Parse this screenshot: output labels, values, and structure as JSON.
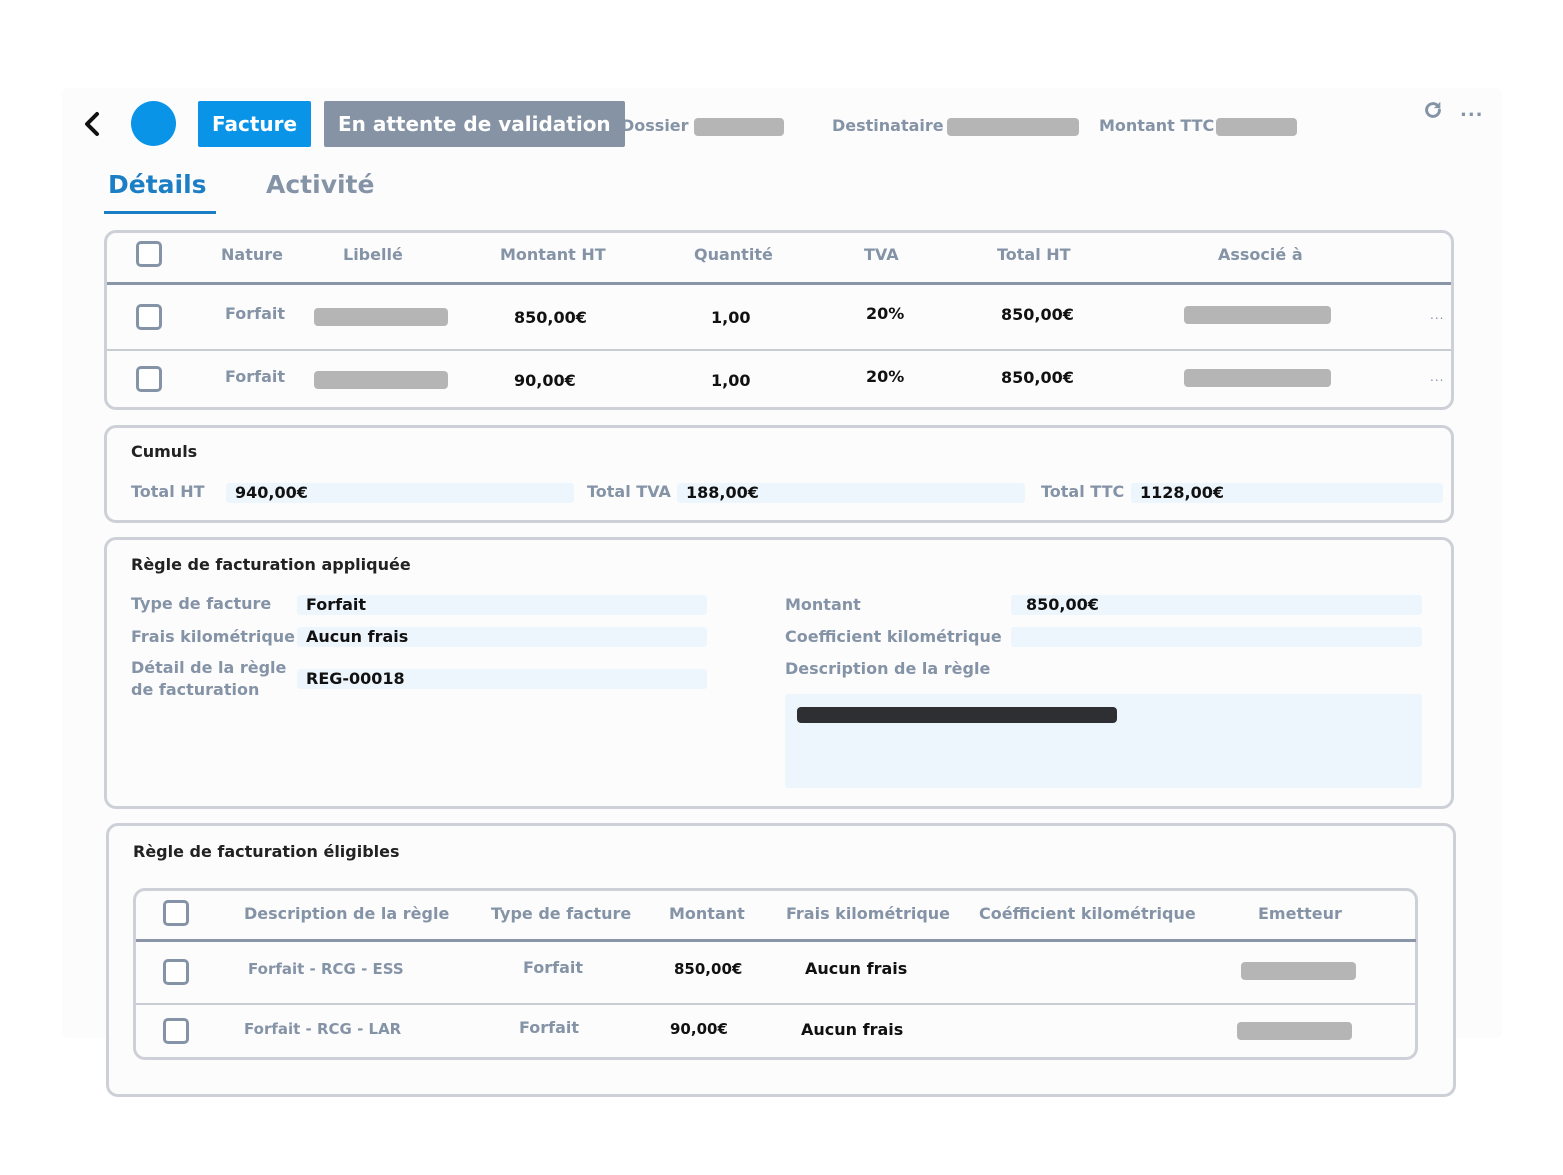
{
  "header": {
    "document_type": "Facture",
    "status": "En attente de validation",
    "dossier_label": "Dossier",
    "destinataire_label": "Destinataire",
    "montant_ttc_label": "Montant TTC",
    "more_label": "..."
  },
  "tabs": [
    {
      "label": "Détails",
      "active": true
    },
    {
      "label": "Activité",
      "active": false
    }
  ],
  "lines_table": {
    "columns": [
      "Nature",
      "Libellé",
      "Montant HT",
      "Quantité",
      "TVA",
      "Total HT",
      "Associé à"
    ],
    "rows": [
      {
        "nature": "Forfait",
        "montant_ht": "850,00€",
        "quantite": "1,00",
        "tva": "20%",
        "total_ht": "850,00€",
        "more": "..."
      },
      {
        "nature": "Forfait",
        "montant_ht": "90,00€",
        "quantite": "1,00",
        "tva": "20%",
        "total_ht": "850,00€",
        "more": "..."
      }
    ]
  },
  "cumuls": {
    "title": "Cumuls",
    "total_ht_label": "Total HT",
    "total_ht": "940,00€",
    "total_tva_label": "Total TVA",
    "total_tva": "188,00€",
    "total_ttc_label": "Total TTC",
    "total_ttc": "1128,00€"
  },
  "regle_appliquee": {
    "title": "Règle de facturation appliquée",
    "type_label": "Type de facture",
    "type_value": "Forfait",
    "frais_label": "Frais kilométrique",
    "frais_value": "Aucun frais",
    "detail_label_1": "Détail de la règle",
    "detail_label_2": "de facturation",
    "detail_value": "REG-00018",
    "montant_label": "Montant",
    "montant_value": "850,00€",
    "coef_label": "Coefficient kilométrique",
    "coef_value": "",
    "description_label": "Description de la règle"
  },
  "regles_eligibles": {
    "title": "Règle de facturation éligibles",
    "columns": [
      "Description de la règle",
      "Type de facture",
      "Montant",
      "Frais kilométrique",
      "Coéfficient kilométrique",
      "Emetteur"
    ],
    "rows": [
      {
        "description": "Forfait - RCG - ESS",
        "type": "Forfait",
        "montant": "850,00€",
        "frais": "Aucun frais"
      },
      {
        "description": "Forfait - RCG - LAR",
        "type": "Forfait",
        "montant": "90,00€",
        "frais": "Aucun frais"
      }
    ]
  },
  "colors": {
    "accent": "#0a94e8",
    "tab_active": "#1c7ec4",
    "status_bg": "#8693a5",
    "label_grey": "#8593a6",
    "field_bg": "#eef6fd"
  },
  "icons": [
    "chevron-left-icon",
    "refresh-icon",
    "more-horizontal-icon"
  ]
}
